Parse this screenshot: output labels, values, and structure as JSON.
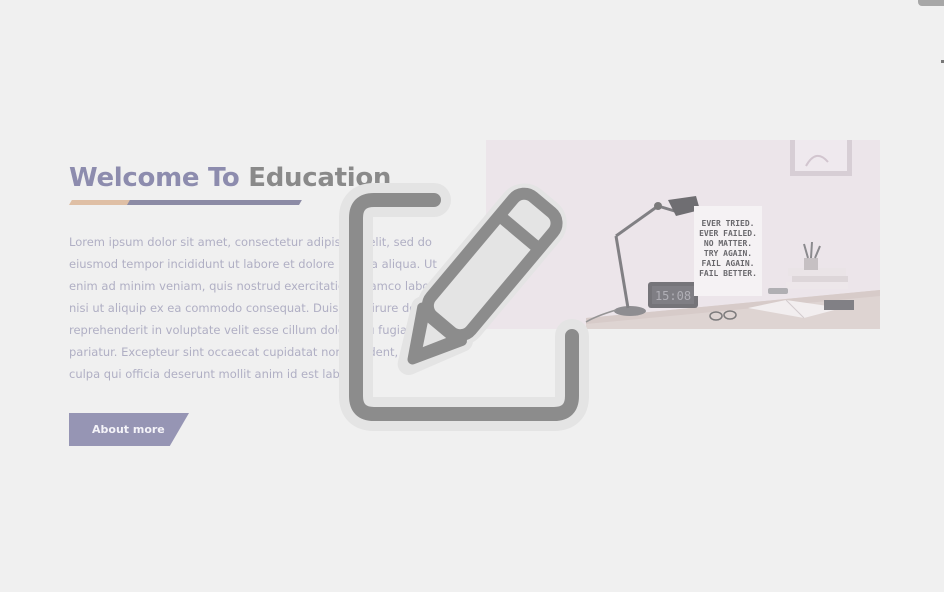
{
  "welcome": {
    "title_accent": "Welcome To",
    "title_main": "Education",
    "paragraph_lines": [
      "Lorem ipsum dolor sit amet, consectetur adipiscing elit, sed do",
      "eiusmod tempor incididunt ut labore et dolore magna aliqua. Ut",
      "enim ad minim veniam, quis nostrud exercitation ullamco laboris",
      "nisi ut aliquip ex ea commodo consequat. Duis aute irure dolor in",
      "reprehenderit in voluptate velit esse cillum dolore eu fugiat nulla",
      "pariatur. Excepteur sint occaecat cupidatat non proident, sunt in",
      "culpa qui officia deserunt mollit anim id est laborum."
    ],
    "button_label": "About more"
  },
  "image": {
    "poster_lines": [
      "EVER TRIED.",
      "EVER FAILED.",
      "NO MATTER.",
      "TRY AGAIN.",
      "FAIL AGAIN.",
      "FAIL BETTER."
    ],
    "clock_text": "15:08"
  },
  "overlay": {
    "icon": "pencil-edit-icon"
  },
  "colors": {
    "accent": "#8d8cae",
    "button": "#9695b4",
    "underline_left": "#dfbfa5",
    "underline_right": "#8c8ba5",
    "background": "#f0f0f0"
  }
}
